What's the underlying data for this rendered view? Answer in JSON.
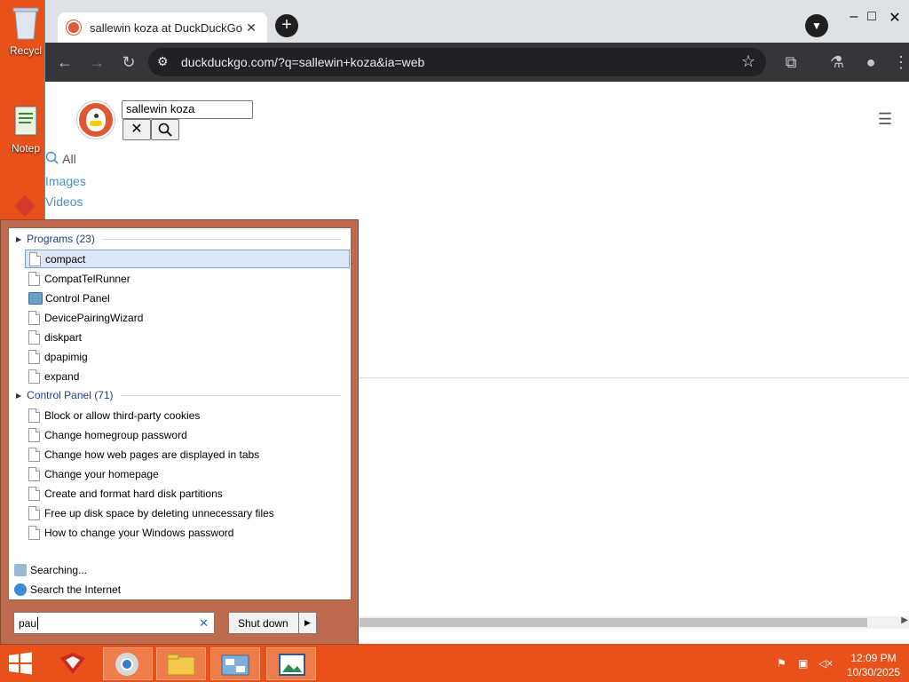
{
  "desktop": {
    "icons": [
      {
        "label": "Recycl"
      },
      {
        "label": "Notep"
      }
    ]
  },
  "browser": {
    "tab_title": "sallewin koza at DuckDuckGo",
    "url": "duckduckgo.com/?q=sallewin+koza&ia=web",
    "search_value": "sallewin koza",
    "nav": {
      "all": "All",
      "images": "Images",
      "videos": "Videos"
    }
  },
  "start_menu": {
    "programs_header": "Programs (23)",
    "programs": [
      "compact",
      "CompatTelRunner",
      "Control Panel",
      "DevicePairingWizard",
      "diskpart",
      "dpapimig",
      "expand"
    ],
    "control_panel_header": "Control Panel (71)",
    "control_panel_items": [
      "Block or allow third-party cookies",
      "Change homegroup password",
      "Change how web pages are displayed in tabs",
      "Change your homepage",
      "Create and format hard disk partitions",
      "Free up disk space by deleting unnecessary files",
      "How to change your Windows password"
    ],
    "searching": "Searching...",
    "search_internet": "Search the Internet",
    "search_value": "pau",
    "shutdown_label": "Shut down"
  },
  "taskbar": {
    "time": "12:09 PM",
    "date": "10/30/2025"
  },
  "colors": {
    "desktop": "#e8511a",
    "start_menu_frame": "#bd6a4e",
    "link": "#4a90c2",
    "ddg": "#de5833"
  }
}
